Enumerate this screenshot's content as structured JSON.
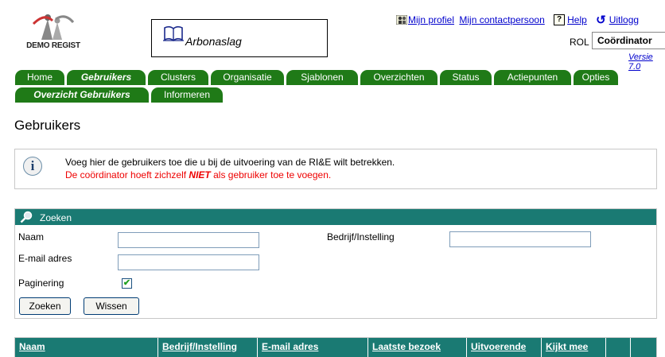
{
  "logo": {
    "part1": "DEMO",
    "part2": "REGIST"
  },
  "header": {
    "title": "Arbonaslag",
    "links": {
      "profile": "Mijn profiel",
      "contact": "Mijn contactpersoon",
      "help": "Help",
      "logout": "Uitlogg"
    },
    "rol_label": "ROL",
    "rol_value": "Coördinator",
    "version": "Versie 7.0"
  },
  "tabs": [
    "Home",
    "Gebruikers",
    "Clusters",
    "Organisatie",
    "Sjablonen",
    "Overzichten",
    "Status",
    "Actiepunten",
    "Opties"
  ],
  "subtabs": [
    "Overzicht Gebruikers",
    "Informeren"
  ],
  "page": {
    "title": "Gebruikers"
  },
  "info": {
    "line1": "Voeg hier de gebruikers toe die u bij de uitvoering van de RI&E wilt betrekken.",
    "line2_before": "De coördinator hoeft zichzelf ",
    "line2_emph": "NIET",
    "line2_after": " als gebruiker toe te voegen."
  },
  "search": {
    "header": "Zoeken",
    "naam_label": "Naam",
    "naam_value": "",
    "bedrijf_label": "Bedrijf/Instelling",
    "bedrijf_value": "",
    "email_label": "E-mail adres",
    "email_value": "",
    "paginering_label": "Paginering",
    "paginering_checked": true,
    "zoeken_button": "Zoeken",
    "wissen_button": "Wissen"
  },
  "table": {
    "columns": [
      "Naam",
      "Bedrijf/Instelling",
      "E-mail adres",
      "Laatste bezoek",
      "Uitvoerende",
      "Kijkt mee",
      "",
      ""
    ]
  },
  "colors": {
    "tab_green": "#1f7a17",
    "header_teal": "#1a7a73",
    "alert_red": "#e00000"
  }
}
